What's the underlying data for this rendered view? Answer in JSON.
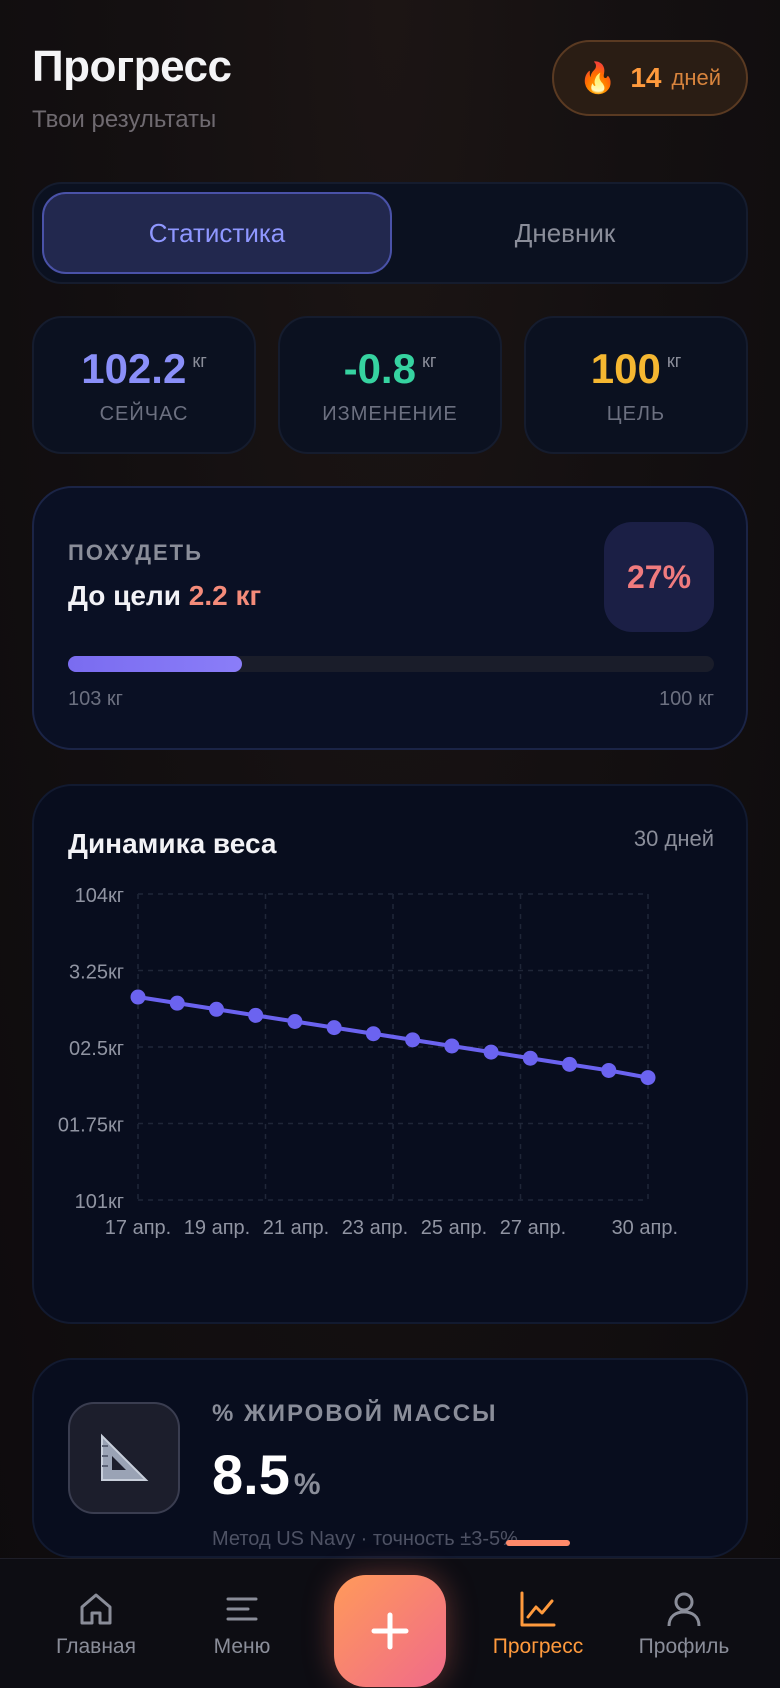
{
  "header": {
    "title": "Прогресс",
    "subtitle": "Твои результаты"
  },
  "streak": {
    "icon": "fire-icon",
    "count": "14",
    "unit": "дней"
  },
  "tabs": [
    {
      "label": "Статистика",
      "active": true
    },
    {
      "label": "Дневник",
      "active": false
    }
  ],
  "stats": [
    {
      "value": "102.2",
      "unit": "кг",
      "label": "СЕЙЧАС",
      "color": "#8a8ff8"
    },
    {
      "value": "-0.8",
      "unit": "кг",
      "label": "ИЗМЕНЕНИЕ",
      "color": "#36d3a0"
    },
    {
      "value": "100",
      "unit": "кг",
      "label": "ЦЕЛЬ",
      "color": "#f5b731"
    }
  ],
  "goal": {
    "type": "ПОХУДЕТЬ",
    "remaining_prefix": "До цели",
    "remaining_value": "2.2 кг",
    "percent_label": "27%",
    "progress_fraction": 0.27,
    "start_label": "103 кг",
    "end_label": "100 кг"
  },
  "chart_card": {
    "title": "Динамика веса",
    "range": "30 дней"
  },
  "chart_data": {
    "type": "line",
    "title": "Динамика веса",
    "y_tick_labels": [
      "104кг",
      "3.25кг",
      "02.5кг",
      "01.75кг",
      "101кг"
    ],
    "y_ticks": [
      104,
      103.25,
      102.5,
      101.75,
      101
    ],
    "ylim": [
      101,
      104
    ],
    "x_tick_labels": [
      "17 апр.",
      "19 апр.",
      "21 апр.",
      "23 апр.",
      "25 апр.",
      "27 апр.",
      "30 апр."
    ],
    "grid": true,
    "series": [
      {
        "color": "#6b63f0",
        "values": [
          102.99,
          102.93,
          102.87,
          102.81,
          102.75,
          102.69,
          102.63,
          102.57,
          102.51,
          102.45,
          102.39,
          102.33,
          102.27,
          102.2
        ]
      }
    ]
  },
  "fat": {
    "icon": "ruler-triangle-icon",
    "label": "% ЖИРОВОЙ МАССЫ",
    "value": "8.5",
    "unit": "%",
    "note": "Метод US Navy · точность ±3-5%"
  },
  "nav": {
    "items": [
      {
        "label": "Главная",
        "icon": "home-icon"
      },
      {
        "label": "Меню",
        "icon": "menu-icon"
      },
      {
        "label": "Прогресс",
        "icon": "chart-icon",
        "active": true
      },
      {
        "label": "Профиль",
        "icon": "profile-icon"
      }
    ],
    "add_icon": "plus-icon"
  }
}
